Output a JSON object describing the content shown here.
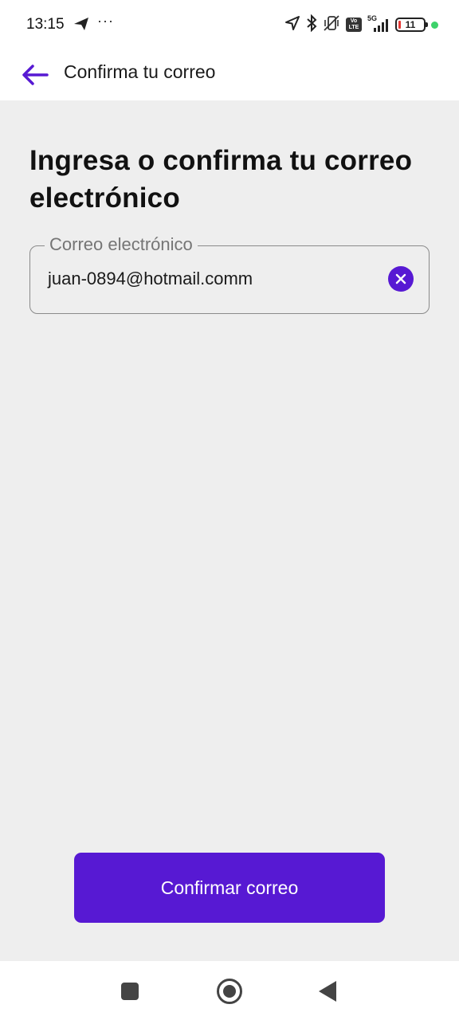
{
  "status_bar": {
    "time": "13:15",
    "more": "···",
    "network_label": "5G",
    "lte_label": "Vo LTE",
    "battery_level": "11"
  },
  "app_bar": {
    "title": "Confirma tu correo"
  },
  "main": {
    "heading": "Ingresa o confirma tu correo electrónico",
    "email_field": {
      "label": "Correo electrónico",
      "value": "juan-0894@hotmail.comm"
    },
    "confirm_button_label": "Confirmar correo"
  },
  "colors": {
    "accent": "#5719d3",
    "background": "#eeeeee",
    "surface": "#ffffff"
  },
  "icons": {
    "back": "arrow-left-icon",
    "clear": "clear-icon",
    "location": "location-arrow-icon",
    "bluetooth": "bluetooth-icon",
    "vibrate": "vibrate-off-icon",
    "signal": "signal-icon",
    "battery": "battery-icon"
  }
}
